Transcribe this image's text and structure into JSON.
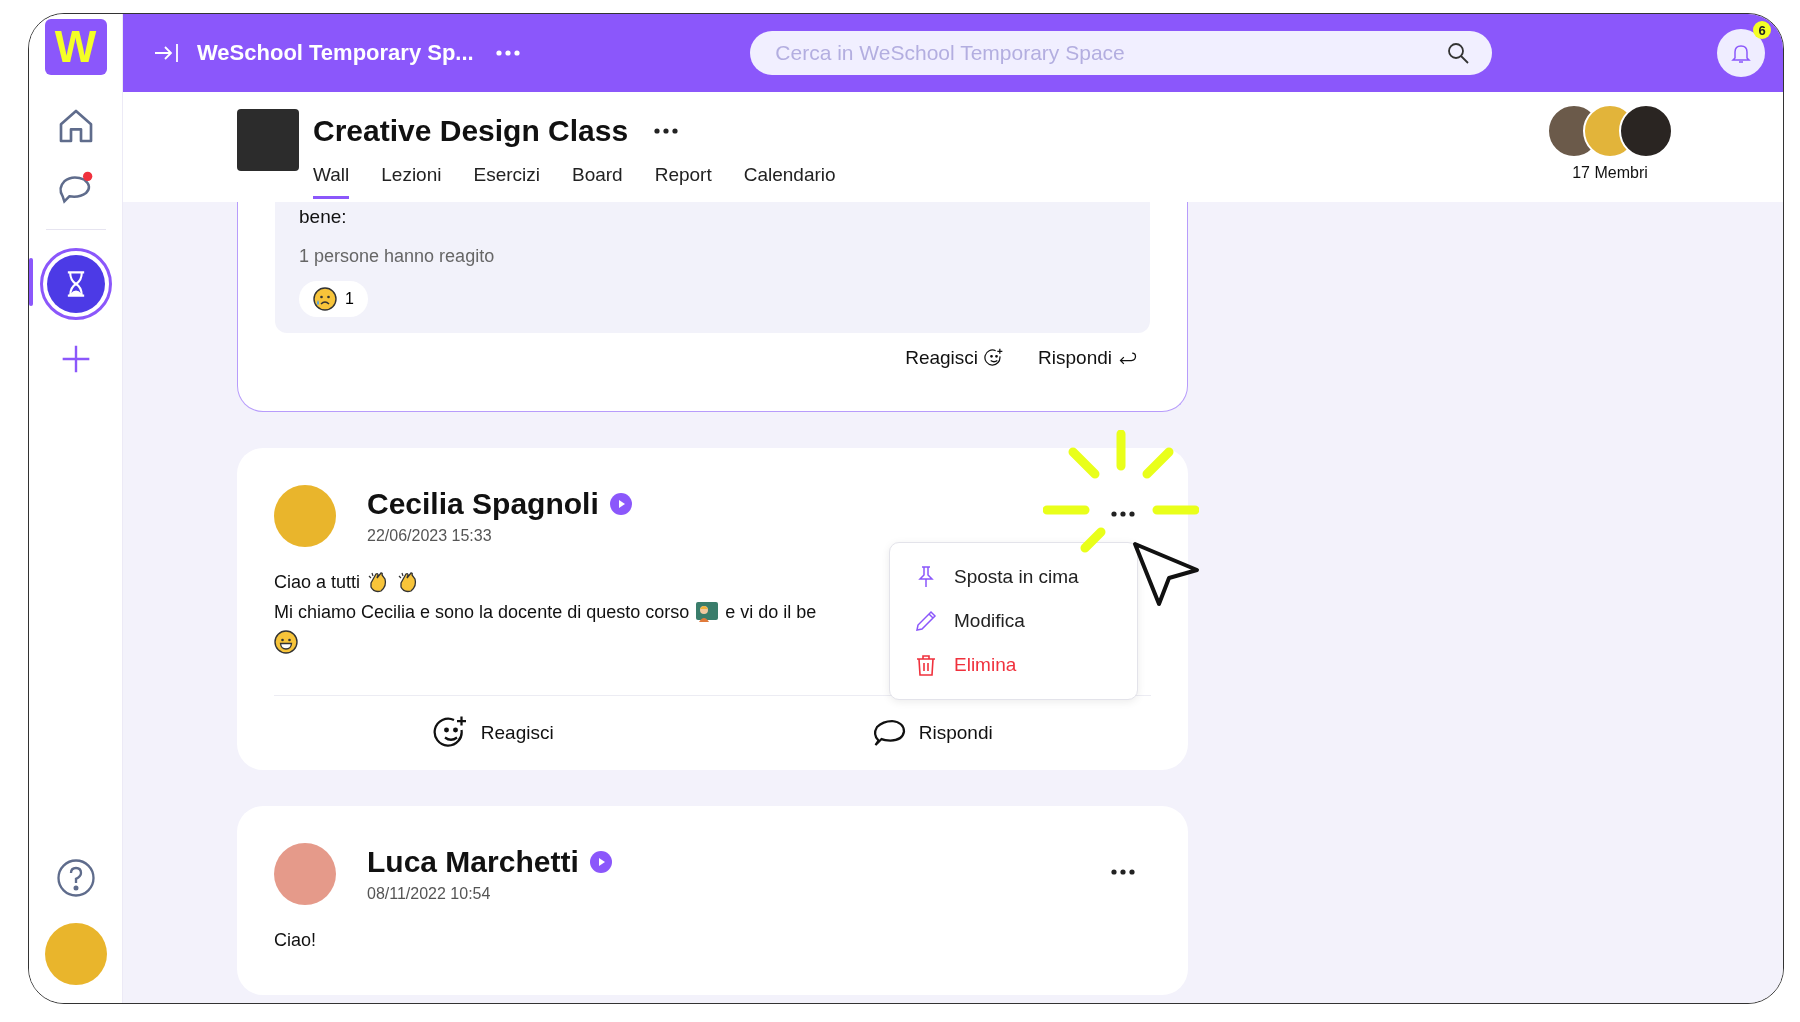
{
  "logo": "W",
  "sidebar": {
    "items": [
      {
        "kind": "home",
        "selected": false
      },
      {
        "kind": "chat",
        "selected": false,
        "unread": true
      },
      {
        "kind": "space",
        "selected": true
      },
      {
        "kind": "add",
        "selected": false
      }
    ],
    "bottom": [
      {
        "kind": "help"
      },
      {
        "kind": "avatar"
      }
    ]
  },
  "topbar": {
    "title": "WeSchool Temporary Sp...",
    "search": {
      "placeholder": "Cerca in WeSchool Temporary Space"
    },
    "notifications": "6"
  },
  "class": {
    "title": "Creative Design Class",
    "tabs": [
      {
        "label": "Wall",
        "selected": true
      },
      {
        "label": "Lezioni",
        "selected": false
      },
      {
        "label": "Esercizi",
        "selected": false
      },
      {
        "label": "Board",
        "selected": false
      },
      {
        "label": "Report",
        "selected": false
      },
      {
        "label": "Calendario",
        "selected": false
      }
    ],
    "members": "17 Membri"
  },
  "thread_end": {
    "body": "bene:",
    "reactions_summary": "1 persone hanno reagito",
    "reactions": [
      {
        "kind": "sad",
        "count": "1"
      }
    ],
    "actions": [
      {
        "kind": "react",
        "label": "Reagisci"
      },
      {
        "kind": "reply",
        "label": "Rispondi"
      }
    ]
  },
  "posts": [
    {
      "author": "Cecilia Spagnoli",
      "date": "22/06/2023 15:33",
      "menu_open": true,
      "lines": [
        [
          {
            "kind": "text",
            "text": "Ciao a tutti"
          },
          {
            "kind": "clap"
          },
          {
            "kind": "clap"
          }
        ],
        [
          {
            "kind": "text",
            "text": "Mi chiamo Cecilia e sono la docente di questo corso"
          },
          {
            "kind": "teacher"
          },
          {
            "kind": "text",
            "text": "e vi do il be"
          }
        ],
        [
          {
            "kind": "grin"
          }
        ]
      ],
      "actions": [
        {
          "kind": "react",
          "label": "Reagisci"
        },
        {
          "kind": "reply",
          "label": "Rispondi"
        }
      ]
    },
    {
      "author": "Luca Marchetti",
      "date": "08/11/2022 10:54",
      "lines": [
        [
          {
            "kind": "text",
            "text": "Ciao!"
          }
        ]
      ]
    }
  ],
  "menu": {
    "items": [
      {
        "kind": "pin",
        "label": "Sposta in cima"
      },
      {
        "kind": "edit",
        "label": "Modifica"
      },
      {
        "kind": "delete",
        "label": "Elimina"
      }
    ]
  }
}
